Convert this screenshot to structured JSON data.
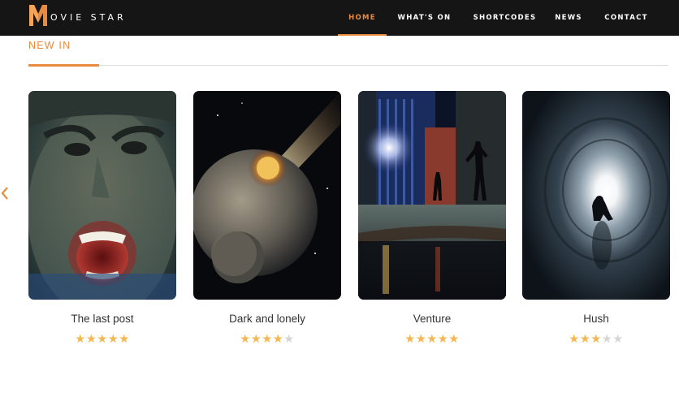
{
  "brand": {
    "logo_letter": "M",
    "logo_text": "OVIE STAR",
    "accent_color": "#e98b3f"
  },
  "nav": {
    "items": [
      {
        "label": "HOME",
        "active": true
      },
      {
        "label": "WHAT'S ON",
        "active": false
      },
      {
        "label": "SHORTCODES",
        "active": false
      },
      {
        "label": "NEWS",
        "active": false
      },
      {
        "label": "CONTACT",
        "active": false
      }
    ]
  },
  "section": {
    "title": "NEW IN"
  },
  "slider": {
    "prev_icon": "chevron-left-icon"
  },
  "movies": [
    {
      "title": "The last post",
      "rating": 5,
      "max_rating": 5,
      "poster": "screaming-child-closeup"
    },
    {
      "title": "Dark and lonely",
      "rating": 4,
      "max_rating": 5,
      "poster": "planet-impact-space"
    },
    {
      "title": "Venture",
      "rating": 5,
      "max_rating": 5,
      "poster": "city-night-alley-reflection"
    },
    {
      "title": "Hush",
      "rating": 3,
      "max_rating": 5,
      "poster": "figure-in-light-tunnel"
    }
  ],
  "colors": {
    "header_bg": "#151515",
    "star_on": "#f5b752",
    "star_off": "#d6d6d6"
  }
}
